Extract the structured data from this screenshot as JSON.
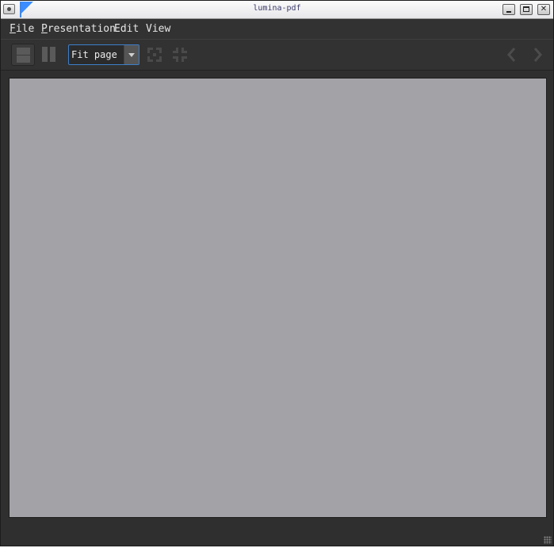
{
  "window": {
    "title": "lumina-pdf"
  },
  "menubar": {
    "items": [
      {
        "mnemonic": "F",
        "rest": "ile"
      },
      {
        "mnemonic": "P",
        "rest": "resentation"
      },
      {
        "mnemonic": "",
        "rest": "Edit"
      },
      {
        "mnemonic": "",
        "rest": "View"
      }
    ]
  },
  "toolbar": {
    "zoom_value": "Fit page",
    "icons": {
      "single_page": "single-page-view-icon",
      "dual_page": "dual-page-view-icon",
      "expand": "expand-icon",
      "shrink": "shrink-icon",
      "prev": "chevron-left-icon",
      "next": "chevron-right-icon"
    }
  },
  "colors": {
    "window_bg": "#2f2f2f",
    "page_bg": "#a3a2a7",
    "combo_border": "#3d7ec9",
    "menu_text": "#e6e6e6"
  }
}
